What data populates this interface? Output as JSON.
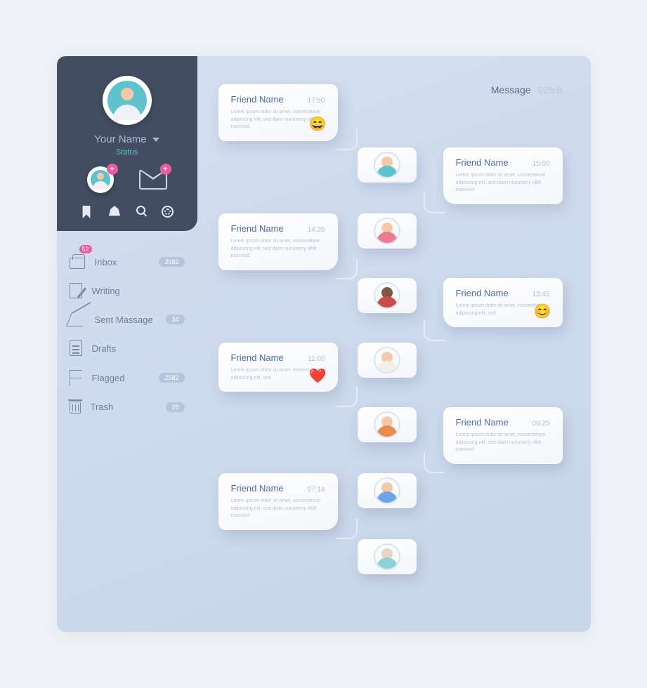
{
  "header": {
    "label": "Message",
    "date": "02feb"
  },
  "profile": {
    "name": "Your Name",
    "status": "Status"
  },
  "nav": {
    "inbox": {
      "label": "Inbox",
      "count": "52",
      "badge": "2582"
    },
    "writing": {
      "label": "Writing"
    },
    "sent": {
      "label": "Sent Massage",
      "badge": "34"
    },
    "drafts": {
      "label": "Drafts"
    },
    "flagged": {
      "label": "Flagged",
      "badge": "2582"
    },
    "trash": {
      "label": "Trash",
      "badge": "28"
    }
  },
  "lorem3": "Lorem ipsum dolor sit amet, consectetuer adipiscing elit, sed diam nonummy nibh euismod",
  "lorem2": "Lorem ipsum dolor sit amet, consectetuer adipiscing elit, sed",
  "msgs": [
    {
      "name": "Friend Name",
      "time": "17:50"
    },
    {
      "name": "Friend Name",
      "time": "15:00"
    },
    {
      "name": "Friend Name",
      "time": "14:35"
    },
    {
      "name": "Friend Name",
      "time": "13:45"
    },
    {
      "name": "Friend Name",
      "time": "11:00"
    },
    {
      "name": "Friend Name",
      "time": "09:25"
    },
    {
      "name": "Friend Name",
      "time": "07:14"
    }
  ],
  "emoji": {
    "laugh": "😄",
    "smile": "😊",
    "heart": "❤️"
  }
}
